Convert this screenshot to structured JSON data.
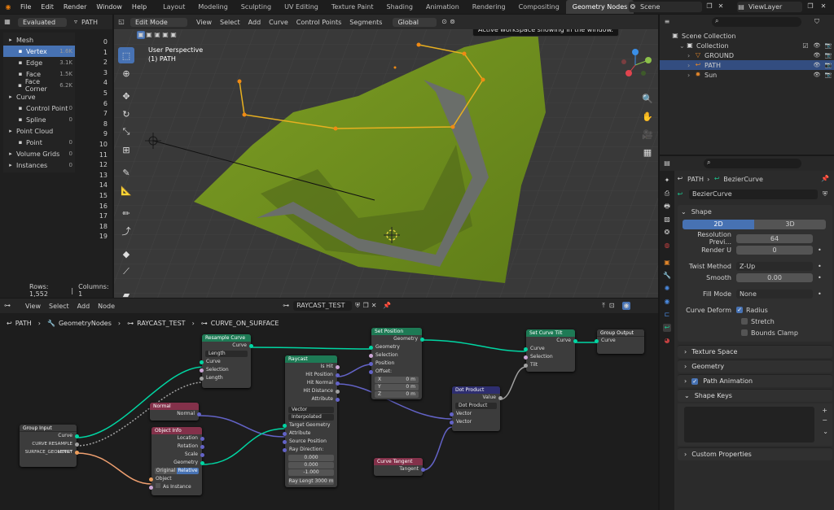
{
  "topmenu": [
    "File",
    "Edit",
    "Render",
    "Window",
    "Help"
  ],
  "workspaces": [
    "Layout",
    "Modeling",
    "Sculpting",
    "UV Editing",
    "Texture Paint",
    "Shading",
    "Animation",
    "Rendering",
    "Compositing",
    "Geometry Nodes",
    "Scripting"
  ],
  "active_workspace": "Geometry Nodes",
  "scene": "Scene",
  "view_layer": "ViewLayer",
  "tooltip": "Active workspace showing in the window.",
  "spreadsheet": {
    "mode": "Evaluated",
    "object": "PATH",
    "tree": [
      {
        "label": "Mesh",
        "count": "",
        "indent": 0
      },
      {
        "label": "Vertex",
        "count": "1.6K",
        "indent": 1,
        "selected": true
      },
      {
        "label": "Edge",
        "count": "3.1K",
        "indent": 1
      },
      {
        "label": "Face",
        "count": "1.5K",
        "indent": 1
      },
      {
        "label": "Face Corner",
        "count": "6.2K",
        "indent": 1
      },
      {
        "label": "Curve",
        "count": "",
        "indent": 0
      },
      {
        "label": "Control Point",
        "count": "0",
        "indent": 1
      },
      {
        "label": "Spline",
        "count": "0",
        "indent": 1
      },
      {
        "label": "Point Cloud",
        "count": "",
        "indent": 0
      },
      {
        "label": "Point",
        "count": "0",
        "indent": 1
      },
      {
        "label": "Volume Grids",
        "count": "0",
        "indent": 0
      },
      {
        "label": "Instances",
        "count": "0",
        "indent": 0
      }
    ],
    "row_numbers": [
      "0",
      "1",
      "2",
      "3",
      "4",
      "5",
      "6",
      "7",
      "8",
      "9",
      "10",
      "11",
      "12",
      "13",
      "14",
      "15",
      "16",
      "17",
      "18",
      "19"
    ],
    "rows_label": "Rows: 1,552",
    "columns_label": "Columns: 1"
  },
  "viewport": {
    "mode": "Edit Mode",
    "menu": [
      "View",
      "Select",
      "Add",
      "Curve",
      "Control Points",
      "Segments"
    ],
    "orientation": "Global",
    "perspective": "User Perspective",
    "object_label": "(1) PATH"
  },
  "outliner": {
    "title": "Scene Collection",
    "items": [
      {
        "label": "Collection",
        "indent": 1
      },
      {
        "label": "GROUND",
        "indent": 2
      },
      {
        "label": "PATH",
        "indent": 2,
        "selected": true
      },
      {
        "label": "Sun",
        "indent": 2
      }
    ]
  },
  "properties": {
    "breadcrumb_object": "PATH",
    "breadcrumb_data": "BezierCurve",
    "datablock": "BezierCurve",
    "shape_section": "Shape",
    "dim_2d": "2D",
    "dim_3d": "3D",
    "resolution_label": "Resolution Previ...",
    "resolution_value": "64",
    "render_u_label": "Render U",
    "render_u_value": "0",
    "twist_method_label": "Twist Method",
    "twist_method_value": "Z-Up",
    "smooth_label": "Smooth",
    "smooth_value": "0.00",
    "fill_mode_label": "Fill Mode",
    "fill_mode_value": "None",
    "curve_deform_label": "Curve Deform",
    "radius_label": "Radius",
    "stretch_label": "Stretch",
    "bounds_clamp_label": "Bounds Clamp",
    "sections": [
      "Texture Space",
      "Geometry",
      "Path Animation",
      "Shape Keys",
      "Custom Properties"
    ]
  },
  "node_editor": {
    "menu": [
      "View",
      "Select",
      "Add",
      "Node"
    ],
    "tree_name": "RAYCAST_TEST",
    "breadcrumb": [
      "PATH",
      "GeometryNodes",
      "RAYCAST_TEST",
      "CURVE_ON_SURFACE"
    ],
    "nodes": {
      "group_input": {
        "title": "Group Input",
        "out1": "Curve",
        "out2": "CURVE RESAMPLE LENGT",
        "out3": "SURFACE_GEOMETRY"
      },
      "resample": {
        "title": "Resample Curve",
        "out": "Curve",
        "mode": "Length",
        "in1": "Curve",
        "in2": "Selection",
        "in3": "Length"
      },
      "normal": {
        "title": "Normal",
        "out": "Normal"
      },
      "object_info": {
        "title": "Object Info",
        "o1": "Location",
        "o2": "Rotation",
        "o3": "Scale",
        "o4": "Geometry",
        "b1": "Original",
        "b2": "Relative",
        "i1": "Object",
        "i2": "As Instance"
      },
      "raycast": {
        "title": "Raycast",
        "o1": "Is Hit",
        "o2": "Hit Position",
        "o3": "Hit Normal",
        "o4": "Hit Distance",
        "o5": "Attribute",
        "dt1": "Vector",
        "dt2": "Interpolated",
        "i1": "Target Geometry",
        "i2": "Attribute",
        "i3": "Source Position",
        "i4": "Ray Direction:",
        "v1": "0.000",
        "v2": "0.000",
        "v3": "-1.000",
        "len": "Ray Lengt  3000 m"
      },
      "set_position": {
        "title": "Set Position",
        "out": "Geometry",
        "i1": "Geometry",
        "i2": "Selection",
        "i3": "Position",
        "i4": "Offset:",
        "x": "X",
        "xv": "0 m",
        "y": "Y",
        "yv": "0 m",
        "z": "Z",
        "zv": "0 m"
      },
      "dot_product": {
        "title": "Dot Product",
        "out": "Value",
        "op": "Dot Product",
        "i1": "Vector",
        "i2": "Vector"
      },
      "curve_tangent": {
        "title": "Curve Tangent",
        "out": "Tangent"
      },
      "set_tilt": {
        "title": "Set Curve Tilt",
        "out": "Curve",
        "i1": "Curve",
        "i2": "Selection",
        "i3": "Tilt"
      },
      "group_output": {
        "title": "Group Output",
        "i1": "Curve"
      }
    }
  },
  "colors": {
    "accent": "#4772b3",
    "geometry": "#00d6a3",
    "node_vector": "#6363c7",
    "node_float": "#a1a1a1",
    "header_green": "#1e7a55",
    "header_red": "#83314a",
    "header_blue": "#2e2e6f"
  }
}
